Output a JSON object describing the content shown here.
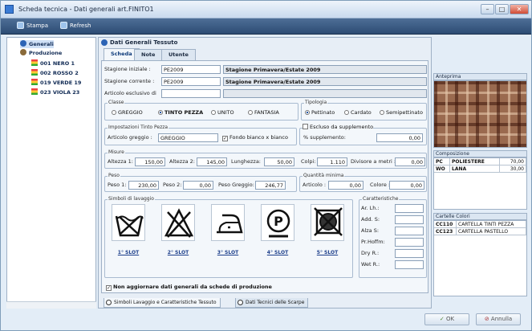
{
  "window": {
    "title": "Scheda tecnica - Dati generali art.FINITO1"
  },
  "toolbar": {
    "print": "Stampa",
    "refresh": "Refresh"
  },
  "tree": {
    "root": "Generali",
    "production": "Produzione",
    "items": [
      "001 NERO 1",
      "002 ROSSO 2",
      "019 VERDE 19",
      "023 VIOLA 23"
    ]
  },
  "main": {
    "header": "Dati Generali Tessuto",
    "tabs": [
      "Scheda",
      "Note",
      "Utente"
    ]
  },
  "stagione": {
    "iniziale_label": "Stagione iniziale :",
    "iniziale_code": "PE2009",
    "iniziale_desc": "Stagione Primavera/Estate 2009",
    "corrente_label": "Stagione corrente :",
    "corrente_code": "PE2009",
    "corrente_desc": "Stagione Primavera/Estate 2009",
    "esclusivo_label": "Articolo esclusivo di"
  },
  "classe": {
    "title": "Classe",
    "options": [
      "GREGGIO",
      "TINTO PEZZA",
      "UNITO",
      "FANTASIA"
    ],
    "selected": "TINTO PEZZA"
  },
  "tipologia": {
    "title": "Tipologia",
    "options": [
      "Pettinato",
      "Cardato",
      "Semipettinato"
    ],
    "selected": "Pettinato"
  },
  "tinto": {
    "title": "Impostazioni Tinto Pezza",
    "articolo_label": "Articolo greggio :",
    "articolo_value": "GREGGIO",
    "fondo_label": "Fondo bianco x bianco"
  },
  "supplemento": {
    "title": "Escluso da supplemento",
    "label": "% supplemento:",
    "value": "0,00"
  },
  "misure": {
    "title": "Misure",
    "altezza1_label": "Altezza 1:",
    "altezza1": "150,00",
    "altezza2_label": "Altezza 2:",
    "altezza2": "145,00",
    "lunghezza_label": "Lunghezza:",
    "lunghezza": "50,00",
    "colpi_label": "Colpi:",
    "colpi": "1.110",
    "divisore_label": "Divisore a metri :",
    "divisore": "0,00"
  },
  "peso": {
    "title": "Peso",
    "peso1_label": "Peso 1:",
    "peso1": "230,00",
    "peso2_label": "Peso 2:",
    "peso2": "0,00",
    "greggio_label": "Peso Greggio:",
    "greggio": "246,77"
  },
  "quantita": {
    "title": "Quantità minima",
    "articolo_label": "Articolo :",
    "articolo": "0,00",
    "colore_label": "Colore :",
    "colore": "0,00"
  },
  "lavaggio": {
    "title": "Simboli di lavaggio",
    "slots": [
      "1° SLOT",
      "2° SLOT",
      "3° SLOT",
      "4° SLOT",
      "5° SLOT"
    ],
    "icons": [
      "wash-basin-icon",
      "no-bleach-icon",
      "iron-icon",
      "dry-clean-p-icon",
      "no-tumble-dry-icon"
    ]
  },
  "caratteristiche": {
    "title": "Caratteristiche",
    "fields": [
      "Ar. Lh.:",
      "Add. S:",
      "Alza S:",
      "Pr.Hoffm:",
      "Dry R.:",
      "Wet R.:"
    ]
  },
  "non_aggiornare": "Non aggiornare dati generali da schede di produzione",
  "bottom_tabs": [
    "Simboli Lavaggio e Caratteristiche Tessuto",
    "Dati Tecnici delle Scarpe"
  ],
  "anteprima": {
    "title": "Anteprima"
  },
  "composizione": {
    "title": "Composizione",
    "rows": [
      [
        "PC",
        "POLIESTERE",
        "70,00"
      ],
      [
        "WO",
        "LANA",
        "30,00"
      ]
    ]
  },
  "cartelle": {
    "title": "Cartelle Colori",
    "rows": [
      [
        "CC110",
        "CARTELLA TINTI PEZZA"
      ],
      [
        "CC123",
        "CARTELLA PASTELLO"
      ]
    ]
  },
  "buttons": {
    "ok": "OK",
    "cancel": "Annulla"
  },
  "colors": {
    "toolbar": "#2c4b73",
    "accent": "#1b3d8a"
  }
}
